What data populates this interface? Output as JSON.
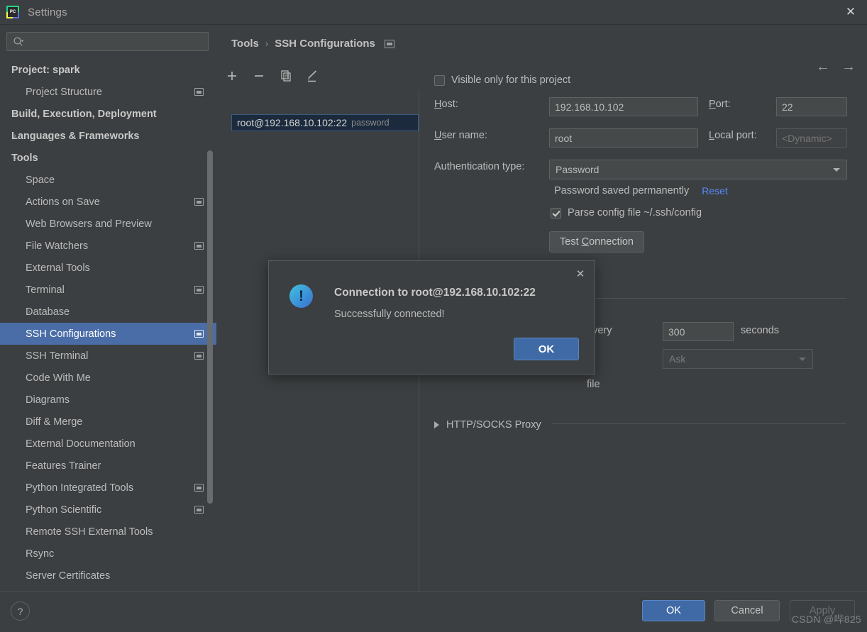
{
  "window": {
    "title": "Settings",
    "logo_text": "PC",
    "close_icon": "✕"
  },
  "sidebar": {
    "search": {
      "placeholder": "",
      "value": "",
      "icon": "search-icon"
    },
    "items": [
      {
        "label": "Project: spark",
        "indent": 0,
        "arrow": "",
        "bold": true,
        "badge": false,
        "selected": false
      },
      {
        "label": "Project Structure",
        "indent": 1,
        "arrow": "",
        "bold": false,
        "badge": true,
        "selected": false
      },
      {
        "label": "Build, Execution, Deployment",
        "indent": 0,
        "arrow": "›",
        "bold": true,
        "badge": false,
        "selected": false
      },
      {
        "label": "Languages & Frameworks",
        "indent": 0,
        "arrow": "›",
        "bold": true,
        "badge": false,
        "selected": false
      },
      {
        "label": "Tools",
        "indent": 0,
        "arrow": "⌄",
        "bold": true,
        "badge": false,
        "selected": false
      },
      {
        "label": "Space",
        "indent": 1,
        "arrow": "",
        "bold": false,
        "badge": false,
        "selected": false
      },
      {
        "label": "Actions on Save",
        "indent": 1,
        "arrow": "",
        "bold": false,
        "badge": true,
        "selected": false
      },
      {
        "label": "Web Browsers and Preview",
        "indent": 1,
        "arrow": "",
        "bold": false,
        "badge": false,
        "selected": false
      },
      {
        "label": "File Watchers",
        "indent": 1,
        "arrow": "",
        "bold": false,
        "badge": true,
        "selected": false
      },
      {
        "label": "External Tools",
        "indent": 1,
        "arrow": "",
        "bold": false,
        "badge": false,
        "selected": false
      },
      {
        "label": "Terminal",
        "indent": 1,
        "arrow": "",
        "bold": false,
        "badge": true,
        "selected": false
      },
      {
        "label": "Database",
        "indent": 1,
        "arrow": "›",
        "bold": false,
        "badge": false,
        "selected": false
      },
      {
        "label": "SSH Configurations",
        "indent": 1,
        "arrow": "",
        "bold": false,
        "badge": true,
        "selected": true
      },
      {
        "label": "SSH Terminal",
        "indent": 1,
        "arrow": "",
        "bold": false,
        "badge": true,
        "selected": false
      },
      {
        "label": "Code With Me",
        "indent": 1,
        "arrow": "",
        "bold": false,
        "badge": false,
        "selected": false
      },
      {
        "label": "Diagrams",
        "indent": 1,
        "arrow": "",
        "bold": false,
        "badge": false,
        "selected": false
      },
      {
        "label": "Diff & Merge",
        "indent": 1,
        "arrow": "›",
        "bold": false,
        "badge": false,
        "selected": false
      },
      {
        "label": "External Documentation",
        "indent": 1,
        "arrow": "",
        "bold": false,
        "badge": false,
        "selected": false
      },
      {
        "label": "Features Trainer",
        "indent": 1,
        "arrow": "",
        "bold": false,
        "badge": false,
        "selected": false
      },
      {
        "label": "Python Integrated Tools",
        "indent": 1,
        "arrow": "",
        "bold": false,
        "badge": true,
        "selected": false
      },
      {
        "label": "Python Scientific",
        "indent": 1,
        "arrow": "",
        "bold": false,
        "badge": true,
        "selected": false
      },
      {
        "label": "Remote SSH External Tools",
        "indent": 1,
        "arrow": "",
        "bold": false,
        "badge": false,
        "selected": false
      },
      {
        "label": "Rsync",
        "indent": 1,
        "arrow": "",
        "bold": false,
        "badge": false,
        "selected": false
      },
      {
        "label": "Server Certificates",
        "indent": 1,
        "arrow": "",
        "bold": false,
        "badge": false,
        "selected": false
      }
    ]
  },
  "content": {
    "breadcrumb": {
      "root": "Tools",
      "separator": "›",
      "current": "SSH Configurations"
    },
    "nav": {
      "back_icon": "←",
      "forward_icon": "→"
    },
    "toolbar": [
      {
        "name": "add-configuration-button",
        "icon": "plus-icon"
      },
      {
        "name": "remove-configuration-button",
        "icon": "minus-icon"
      },
      {
        "name": "copy-configuration-button",
        "icon": "copy-icon"
      },
      {
        "name": "edit-configuration-button",
        "icon": "pencil-icon"
      }
    ],
    "configurations": [
      {
        "label": "root@192.168.10.102:22",
        "auth": "password",
        "selected": true
      }
    ]
  },
  "form": {
    "visible_only_label": "Visible only for this project",
    "visible_only_checked": false,
    "host_label": "Host:",
    "host_label_mnemonic": "H",
    "host_value": "192.168.10.102",
    "port_label": "Port:",
    "port_label_mnemonic": "P",
    "port_value": "22",
    "username_label": "User name:",
    "username_label_mnemonic": "U",
    "username_value": "root",
    "local_port_label": "Local port:",
    "local_port_label_mnemonic": "L",
    "local_port_placeholder": "<Dynamic>",
    "auth_type_label": "Authentication type:",
    "auth_type_value": "Password",
    "password_saved_text": "Password saved permanently",
    "reset_link": "Reset",
    "parse_config_label": "Parse config file ~/.ssh/config",
    "parse_config_checked": true,
    "test_connection_label": "Test Connection",
    "test_connection_mnemonic": "C",
    "every_label": "every",
    "interval_value": "300",
    "seconds_label": "seconds",
    "ask_value": "Ask",
    "file_label": "file",
    "proxy_section_label": "HTTP/SOCKS Proxy"
  },
  "dialog": {
    "title": "Connection to root@192.168.10.102:22",
    "message": "Successfully connected!",
    "ok_label": "OK",
    "close_icon": "✕",
    "icon": "info-exclamation-icon"
  },
  "footer": {
    "help_label": "?",
    "ok_label": "OK",
    "cancel_label": "Cancel",
    "apply_label": "Apply",
    "watermark": "CSDN @哔825"
  },
  "colors": {
    "background": "#3c3f41",
    "selection_blue": "#4a6da7",
    "primary_button": "#3f6aa6",
    "link_blue": "#548af7",
    "list_item_bg": "#1b2a3c"
  }
}
